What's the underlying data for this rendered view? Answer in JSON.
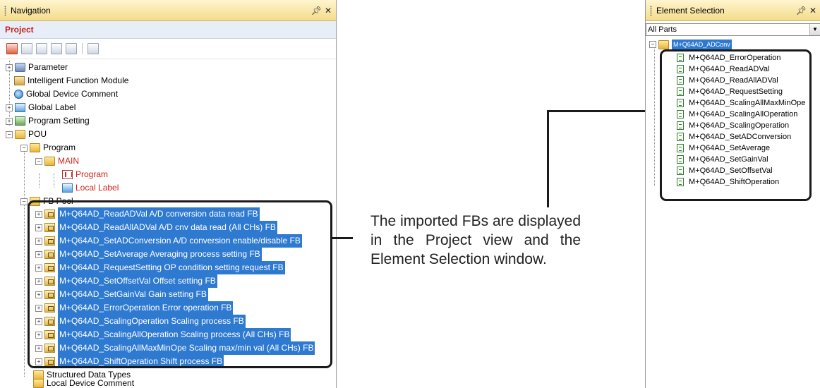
{
  "navigation": {
    "title": "Navigation",
    "pin": "p",
    "close": "×",
    "header": "Project",
    "tree": {
      "top_items": [
        "Parameter",
        "Intelligent Function Module",
        "Global Device Comment",
        "Global Label",
        "Program Setting",
        "POU"
      ],
      "program_folder": "Program",
      "main": "MAIN",
      "main_children": [
        "Program",
        "Local Label"
      ],
      "fb_pool": "FB Pool",
      "fb_items": [
        "M+Q64AD_ReadADVal A/D conversion data read FB",
        "M+Q64AD_ReadAllADVal A/D cnv data read (All CHs) FB",
        "M+Q64AD_SetADConversion A/D conversion enable/disable FB",
        "M+Q64AD_SetAverage Averaging process setting FB",
        "M+Q64AD_RequestSetting OP condition setting request FB",
        "M+Q64AD_SetOffsetVal Offset setting FB",
        "M+Q64AD_SetGainVal Gain setting FB",
        "M+Q64AD_ErrorOperation Error operation FB",
        "M+Q64AD_ScalingOperation Scaling process FB",
        "M+Q64AD_ScalingAllOperation Scaling process (All CHs) FB",
        "M+Q64AD_ScalingAllMaxMinOpe Scaling max/min val (All CHs) FB",
        "M+Q64AD_ShiftOperation Shift process FB"
      ],
      "structured": "Structured Data Types",
      "local_comment": "Local Device Comment"
    }
  },
  "annotation": "The imported FBs are displayed in the Project view and the Element Selection window.",
  "element_selection": {
    "title": "Element Selection",
    "pin": "p",
    "close": "×",
    "filter": "All Parts",
    "root": "M+Q64AD_ADConv",
    "items": [
      "M+Q64AD_ErrorOperation",
      "M+Q64AD_ReadADVal",
      "M+Q64AD_ReadAllADVal",
      "M+Q64AD_RequestSetting",
      "M+Q64AD_ScalingAllMaxMinOpe",
      "M+Q64AD_ScalingAllOperation",
      "M+Q64AD_ScalingOperation",
      "M+Q64AD_SetADConversion",
      "M+Q64AD_SetAverage",
      "M+Q64AD_SetGainVal",
      "M+Q64AD_SetOffsetVal",
      "M+Q64AD_ShiftOperation"
    ]
  },
  "colors": {
    "selection": "#2f7ad1",
    "red_text": "#d2221a",
    "project_header": "#c8211b"
  }
}
